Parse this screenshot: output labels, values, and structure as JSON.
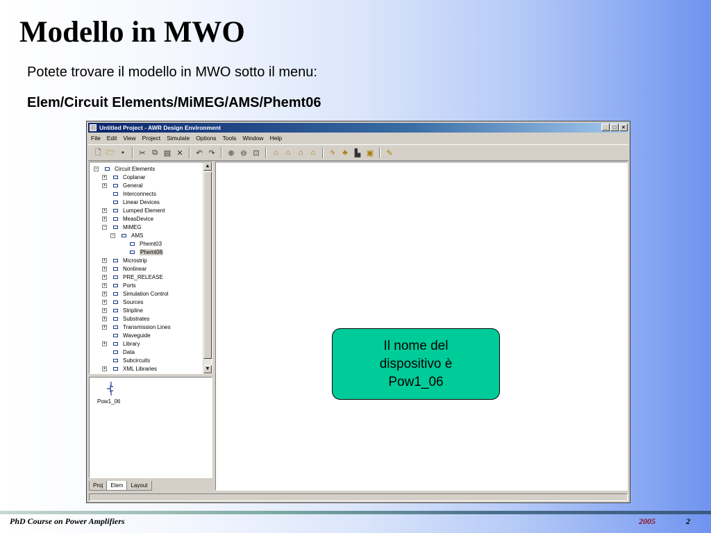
{
  "slide": {
    "title": "Modello in MWO",
    "line1": "Potete trovare il modello in MWO sotto il menu:",
    "line2": "Elem/Circuit Elements/MiMEG/AMS/Phemt06"
  },
  "window": {
    "title": "Untitled Project - AWR Design Environment",
    "menu": [
      "File",
      "Edit",
      "View",
      "Project",
      "Simulate",
      "Options",
      "Tools",
      "Window",
      "Help"
    ],
    "tree": [
      {
        "label": "Circuit Elements",
        "level": 0,
        "exp": "minus",
        "icon": "circuit-elements-icon"
      },
      {
        "label": "Coplanar",
        "level": 1,
        "exp": "plus",
        "icon": "coplanar-icon"
      },
      {
        "label": "General",
        "level": 1,
        "exp": "plus",
        "icon": "general-icon"
      },
      {
        "label": "Interconnects",
        "level": 1,
        "exp": "none",
        "icon": "interconnects-icon"
      },
      {
        "label": "Linear Devices",
        "level": 1,
        "exp": "none",
        "icon": "linear-devices-icon"
      },
      {
        "label": "Lumped Element",
        "level": 1,
        "exp": "plus",
        "icon": "lumped-element-icon"
      },
      {
        "label": "MeasDevice",
        "level": 1,
        "exp": "plus",
        "icon": "measdevice-icon"
      },
      {
        "label": "MiMEG",
        "level": 1,
        "exp": "minus",
        "icon": "mimeg-icon"
      },
      {
        "label": "AMS",
        "level": 2,
        "exp": "minus",
        "icon": "ams-icon"
      },
      {
        "label": "Phemt03",
        "level": 3,
        "exp": "none",
        "icon": "phemt03-icon"
      },
      {
        "label": "Phemt06",
        "level": 3,
        "exp": "none",
        "icon": "phemt06-icon",
        "selected": true
      },
      {
        "label": "Microstrip",
        "level": 1,
        "exp": "plus",
        "icon": "microstrip-icon"
      },
      {
        "label": "Nonlinear",
        "level": 1,
        "exp": "plus",
        "icon": "nonlinear-icon"
      },
      {
        "label": "PRE_RELEASE",
        "level": 1,
        "exp": "plus",
        "icon": "pre-release-icon"
      },
      {
        "label": "Ports",
        "level": 1,
        "exp": "plus",
        "icon": "ports-icon"
      },
      {
        "label": "Simulation Control",
        "level": 1,
        "exp": "plus",
        "icon": "simulation-control-icon"
      },
      {
        "label": "Sources",
        "level": 1,
        "exp": "plus",
        "icon": "sources-icon"
      },
      {
        "label": "Stripline",
        "level": 1,
        "exp": "plus",
        "icon": "stripline-icon"
      },
      {
        "label": "Substrates",
        "level": 1,
        "exp": "plus",
        "icon": "substrates-icon"
      },
      {
        "label": "Transmission Lines",
        "level": 1,
        "exp": "plus",
        "icon": "transmission-lines-icon"
      },
      {
        "label": "Waveguide",
        "level": 1,
        "exp": "none",
        "icon": "waveguide-icon"
      },
      {
        "label": "Library",
        "level": 1,
        "exp": "plus",
        "icon": "library-folder-icon"
      },
      {
        "label": "Data",
        "level": 1,
        "exp": "none",
        "icon": "data-folder-icon"
      },
      {
        "label": "Subcircuits",
        "level": 1,
        "exp": "none",
        "icon": "subcircuits-icon"
      },
      {
        "label": "XML Libraries",
        "level": 1,
        "exp": "plus",
        "icon": "xml-libraries-icon"
      }
    ],
    "preview_label": "Pow1_06",
    "tabs": [
      "Proj",
      "Elem",
      "Layout"
    ],
    "active_tab": "Elem"
  },
  "callout": "Il nome del dispositivo è Pow1_06",
  "footer": {
    "left": "PhD Course on Power Amplifiers",
    "year": "2005",
    "page": "2"
  },
  "colors": {
    "callout_fill": "#00cc99",
    "titlebar": "#0a246a",
    "year_text": "#8a1020"
  }
}
